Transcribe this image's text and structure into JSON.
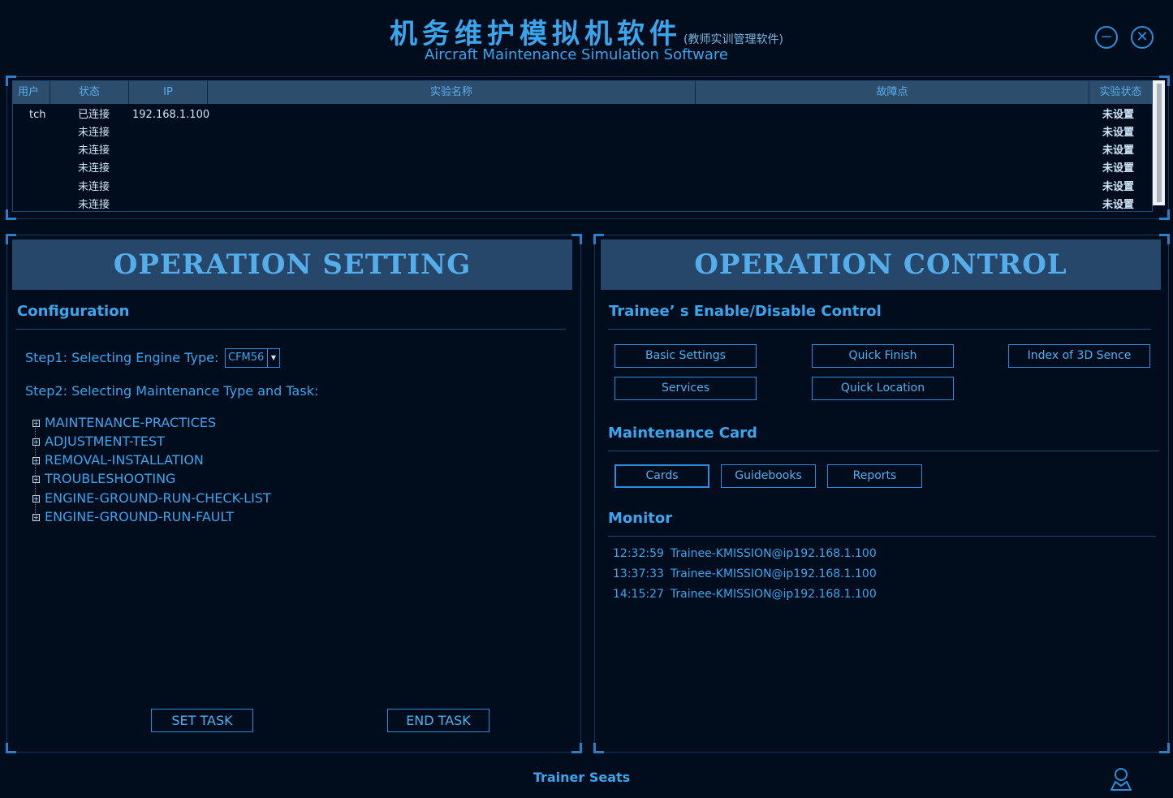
{
  "header": {
    "title_cn": "机务维护模拟机软件",
    "title_cn_sub": "(教师实训管理软件)",
    "title_en": "Aircraft Maintenance Simulation Software",
    "minimize_icon": "minus-circle-icon",
    "close_icon": "close-circle-icon"
  },
  "table": {
    "columns": [
      "用户",
      "状态",
      "IP",
      "实验名称",
      "故障点",
      "实验状态"
    ],
    "rows": [
      {
        "user": "tch",
        "status": "已连接",
        "ip": "192.168.1.100",
        "exp_name": "",
        "fault": "",
        "exp_status": "未设置"
      },
      {
        "user": "",
        "status": "未连接",
        "ip": "",
        "exp_name": "",
        "fault": "",
        "exp_status": "未设置"
      },
      {
        "user": "",
        "status": "未连接",
        "ip": "",
        "exp_name": "",
        "fault": "",
        "exp_status": "未设置"
      },
      {
        "user": "",
        "status": "未连接",
        "ip": "",
        "exp_name": "",
        "fault": "",
        "exp_status": "未设置"
      },
      {
        "user": "",
        "status": "未连接",
        "ip": "",
        "exp_name": "",
        "fault": "",
        "exp_status": "未设置"
      },
      {
        "user": "",
        "status": "未连接",
        "ip": "",
        "exp_name": "",
        "fault": "",
        "exp_status": "未设置"
      }
    ]
  },
  "setting": {
    "title": "OPERATION SETTING",
    "config_heading": "Configuration",
    "step1_label": "Step1:  Selecting Engine Type:",
    "engine_value": "CFM56",
    "step2_label": "Step2: Selecting Maintenance Type and Task:",
    "tree": [
      "MAINTENANCE-PRACTICES",
      "ADJUSTMENT-TEST",
      "REMOVAL-INSTALLATION",
      "TROUBLESHOOTING",
      "ENGINE-GROUND-RUN-CHECK-LIST",
      "ENGINE-GROUND-RUN-FAULT"
    ],
    "set_task": "SET  TASK",
    "end_task": "END  TASK"
  },
  "control": {
    "title": "OPERATION CONTROL",
    "enable_heading": "Trainee’ s Enable/Disable Control",
    "buttons": [
      "Basic Settings",
      "Quick Finish",
      "Index of 3D Sence",
      "Services",
      "Quick Location"
    ],
    "card_heading": "Maintenance Card",
    "card_buttons": [
      "Cards",
      "Guidebooks",
      "Reports"
    ],
    "monitor_heading": "Monitor",
    "monitor": [
      {
        "time": "12:32:59",
        "msg": "Trainee-KMISSION@ip192.168.1.100"
      },
      {
        "time": "13:37:33",
        "msg": "Trainee-KMISSION@ip192.168.1.100"
      },
      {
        "time": "14:15:27",
        "msg": "Trainee-KMISSION@ip192.168.1.100"
      }
    ]
  },
  "footer": {
    "label": "Trainer Seats",
    "user_icon": "user-icon"
  },
  "colors": {
    "background": "#010c1d",
    "accent": "#3aa6ee",
    "panel_header": "#26476a"
  }
}
